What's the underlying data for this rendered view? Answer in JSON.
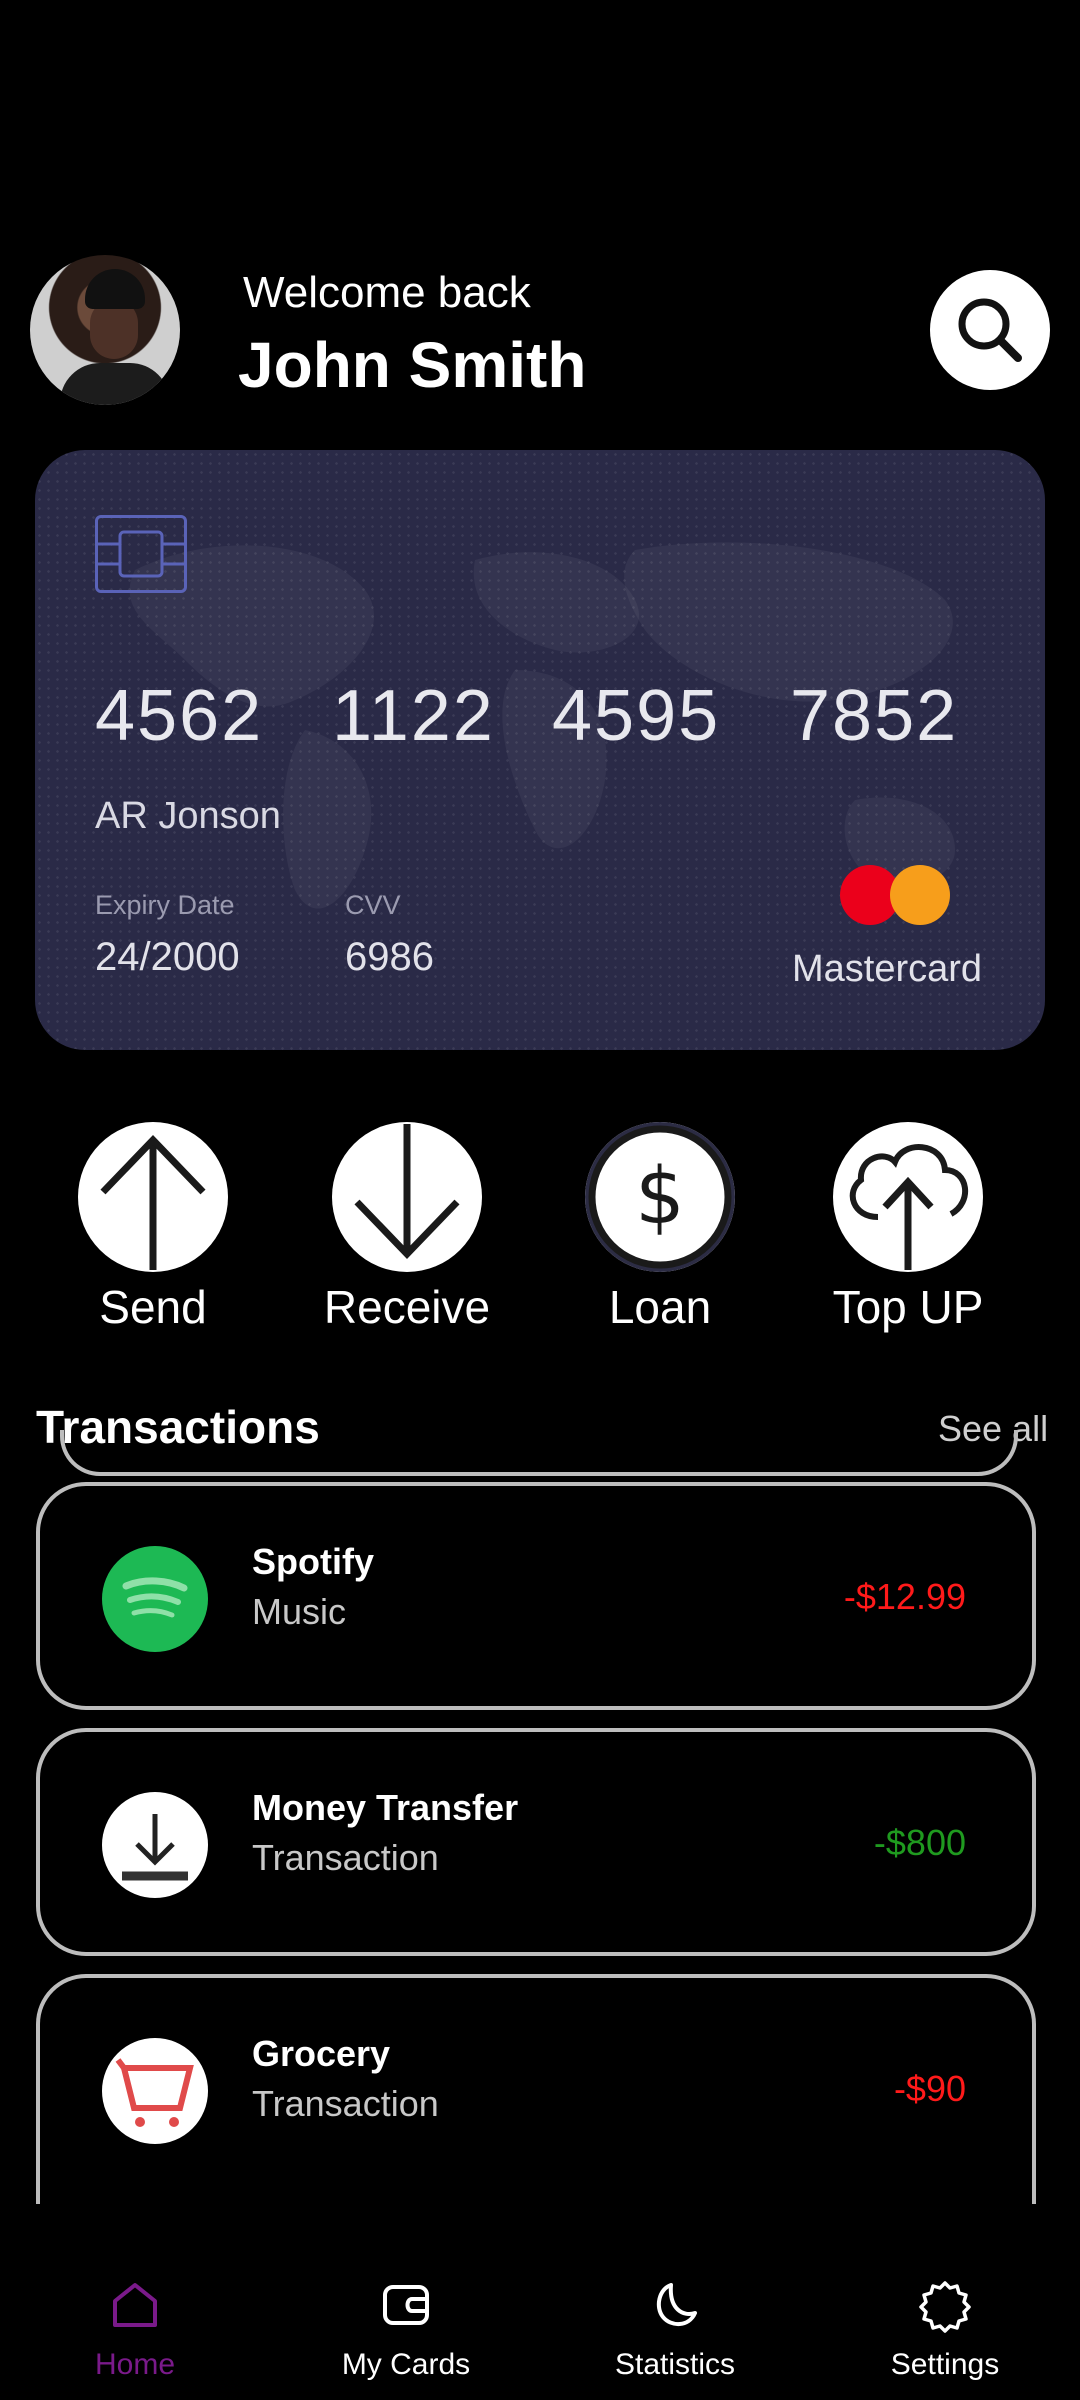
{
  "header": {
    "welcome": "Welcome back",
    "username": "John Smith"
  },
  "card": {
    "number_groups": [
      "4562",
      "1122",
      "4595",
      "7852"
    ],
    "holder": "AR Jonson",
    "expiry_label": "Expiry Date",
    "expiry_value": "24/2000",
    "cvv_label": "CVV",
    "cvv_value": "6986",
    "brand": "Mastercard",
    "background": "#2a2a47"
  },
  "actions": [
    {
      "label": "Send",
      "icon": "arrow-up-icon"
    },
    {
      "label": "Receive",
      "icon": "arrow-down-icon"
    },
    {
      "label": "Loan",
      "icon": "dollar-icon"
    },
    {
      "label": "Top UP",
      "icon": "cloud-upload-icon"
    }
  ],
  "transactions": {
    "title": "Transactions",
    "see_all": "See all",
    "items": [
      {
        "name": "Spotify",
        "category": "Music",
        "amount": "-$12.99",
        "amount_color": "#ff1a1a",
        "icon": "spotify-icon"
      },
      {
        "name": "Money Transfer",
        "category": "Transaction",
        "amount": "-$800",
        "amount_color": "#1f9a1f",
        "icon": "download-icon"
      },
      {
        "name": "Grocery",
        "category": "Transaction",
        "amount": "-$90",
        "amount_color": "#ff1a1a",
        "icon": "cart-icon"
      }
    ]
  },
  "nav": {
    "items": [
      {
        "label": "Home",
        "active": true,
        "icon": "home-icon"
      },
      {
        "label": "My Cards",
        "active": false,
        "icon": "wallet-icon"
      },
      {
        "label": "Statistics",
        "active": false,
        "icon": "moon-icon"
      },
      {
        "label": "Settings",
        "active": false,
        "icon": "gear-icon"
      }
    ],
    "active_color": "#7a1a8a"
  }
}
